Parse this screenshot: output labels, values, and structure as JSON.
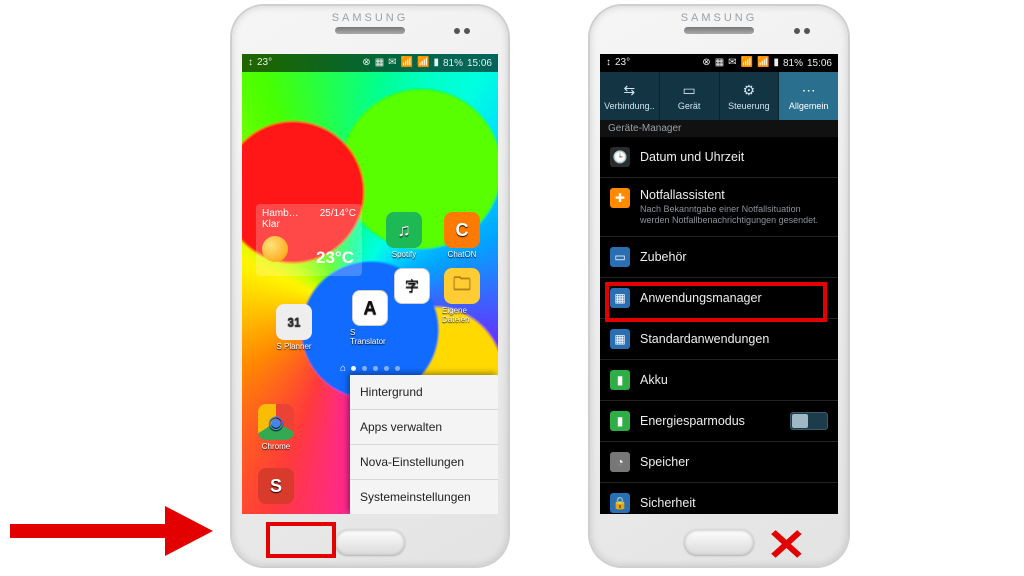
{
  "statusbar": {
    "left_icons": [
      "↕",
      "23°"
    ],
    "right_icons": [
      "⊗",
      "▦",
      "✉",
      "📶",
      "📶"
    ],
    "battery_pct": "81%",
    "time": "15:06"
  },
  "brand": "SAMSUNG",
  "left_phone": {
    "weather": {
      "city": "Hamb…",
      "hilo": "25/14°C",
      "cond": "Klar",
      "temp": "23°C"
    },
    "icons": {
      "spotify": {
        "label": "Spotify",
        "bg": "#1db954",
        "glyph": "♫"
      },
      "chaton": {
        "label": "ChatON",
        "bg": "#ff7a00",
        "glyph": "C"
      },
      "folder": {
        "label": "Eigene Dateien",
        "bg": "#ffcc33",
        "glyph": "🗀"
      },
      "splanner": {
        "label": "S Planner",
        "bg": "#eeeeee",
        "glyph": "31"
      },
      "atrans": {
        "label": "S Translator",
        "bg": "#ffffff",
        "glyph": "A"
      },
      "aztrans": {
        "label": "",
        "bg": "#ffffff",
        "glyph": "字"
      },
      "chrome": {
        "label": "Chrome",
        "bg": "#ffffff",
        "glyph": "◉"
      },
      "sapp": {
        "label": "",
        "bg": "#d83a2b",
        "glyph": "S"
      }
    },
    "context_menu": [
      "Hintergrund",
      "Apps verwalten",
      "Nova-Einstellungen",
      "Systemeinstellungen"
    ]
  },
  "right_phone": {
    "tabs": [
      {
        "label": "Verbindung..",
        "glyph": "⇆"
      },
      {
        "label": "Gerät",
        "glyph": "▭"
      },
      {
        "label": "Steuerung",
        "glyph": "⚙"
      },
      {
        "label": "Allgemein",
        "glyph": "⋯",
        "active": true
      }
    ],
    "section_header": "Geräte-Manager",
    "rows": {
      "datetime": {
        "label": "Datum und Uhrzeit",
        "bg": "#2b2b2b",
        "glyph": "🕒"
      },
      "emergency": {
        "label": "Notfallassistent",
        "sub": "Nach Bekanntgabe einer Notfallsituation werden Notfallbenachrichtigungen gesendet.",
        "bg": "#ff8a00",
        "glyph": "✚"
      },
      "accessory": {
        "label": "Zubehör",
        "bg": "#2b6fb3",
        "glyph": "▭"
      },
      "appmgr": {
        "label": "Anwendungsmanager",
        "bg": "#2b6fb3",
        "glyph": "▦"
      },
      "defapps": {
        "label": "Standardanwendungen",
        "bg": "#2b6fb3",
        "glyph": "▦"
      },
      "battery": {
        "label": "Akku",
        "bg": "#2fae46",
        "glyph": "▮"
      },
      "powersave": {
        "label": "Energiesparmodus",
        "bg": "#2fae46",
        "glyph": "▮",
        "toggle": true
      },
      "storage": {
        "label": "Speicher",
        "bg": "#777777",
        "glyph": "◔"
      },
      "security": {
        "label": "Sicherheit",
        "bg": "#2b6fb3",
        "glyph": "🔒"
      }
    }
  }
}
